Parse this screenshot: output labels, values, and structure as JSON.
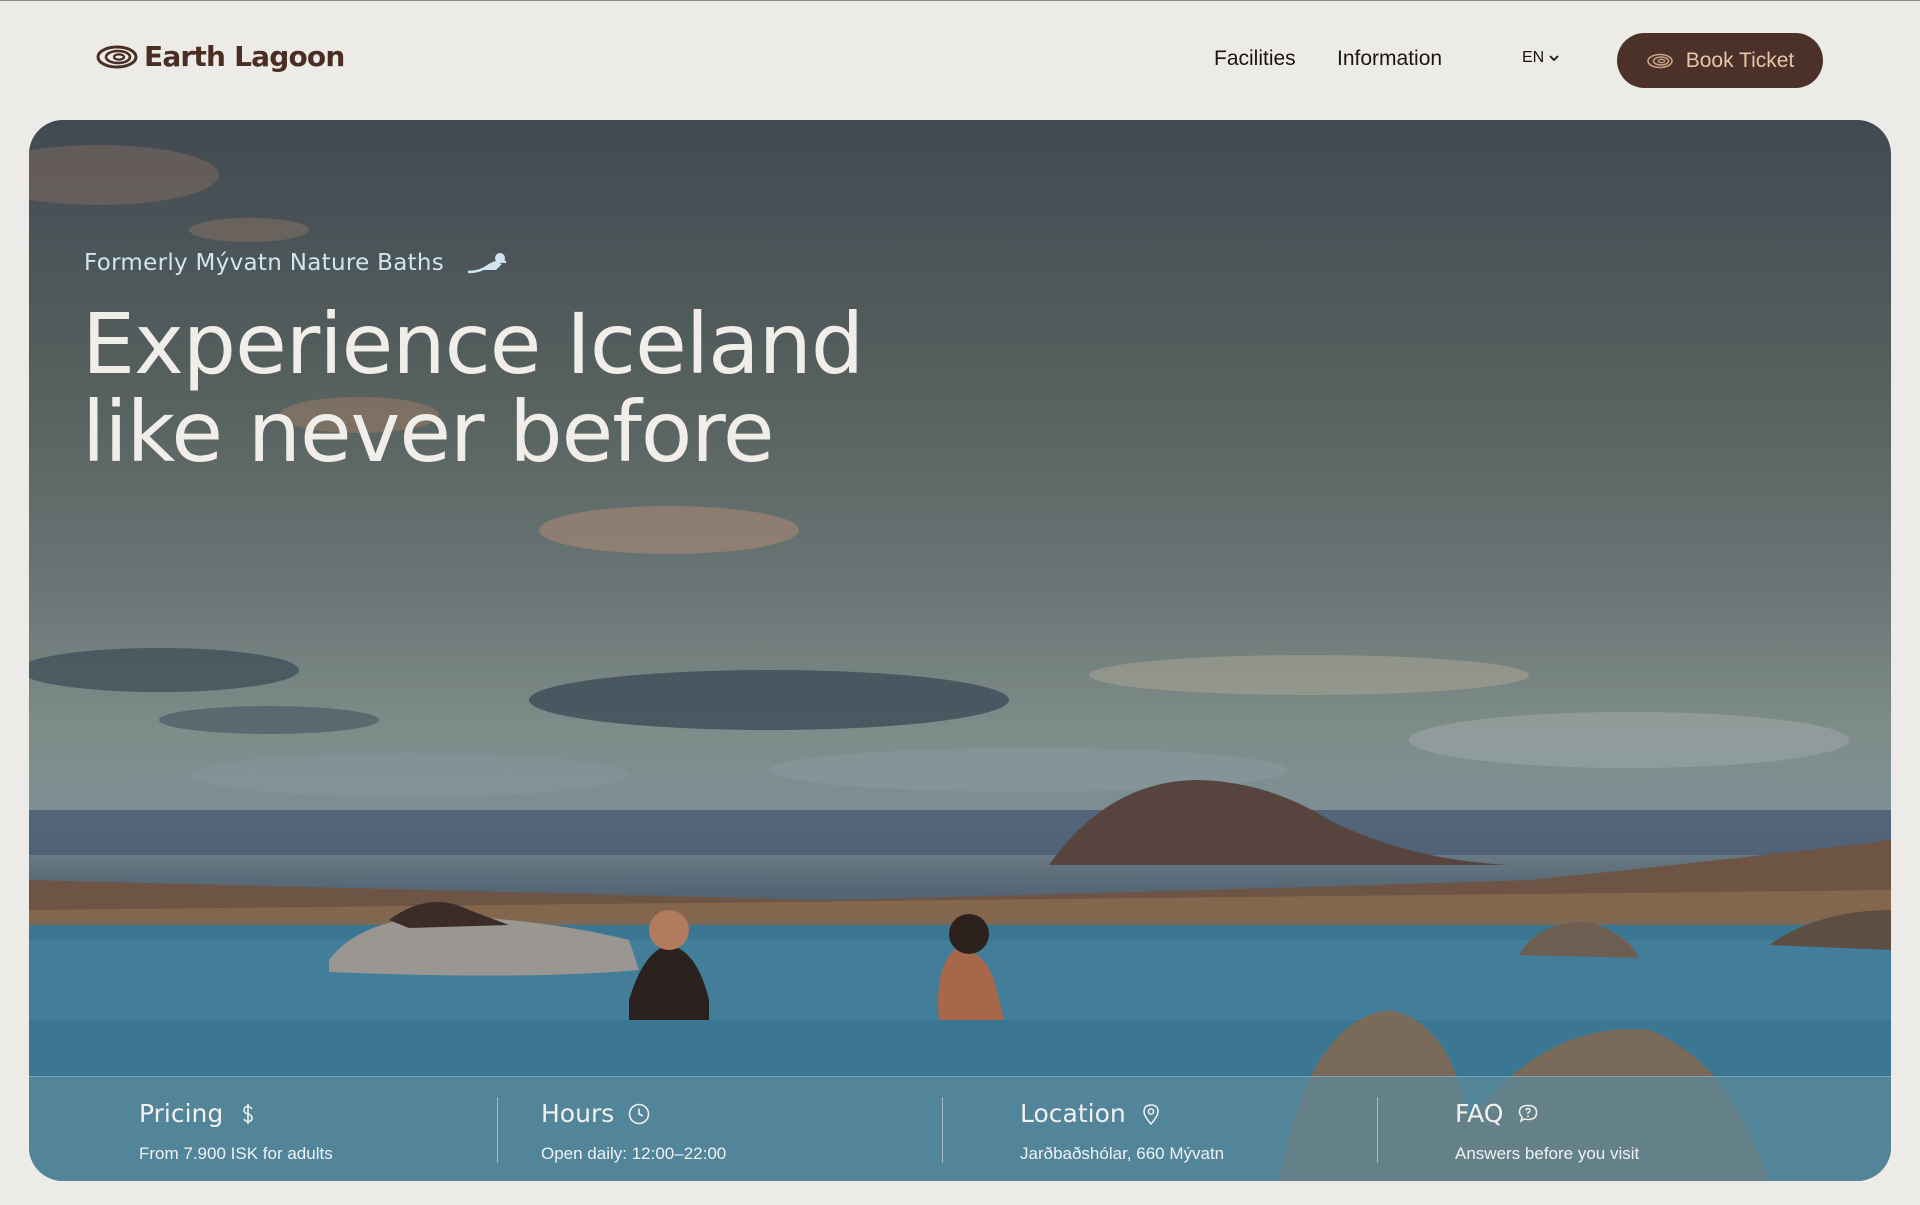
{
  "brand": {
    "name": "Earth Lagoon",
    "color": "#4a2e24"
  },
  "nav": {
    "facilities": "Facilities",
    "information": "Information",
    "language": "EN",
    "book_ticket": "Book Ticket"
  },
  "hero": {
    "eyebrow": "Formerly Mývatn Nature Baths",
    "headline_line1": "Experience Iceland",
    "headline_line2": "like never before"
  },
  "info": [
    {
      "title": "Pricing",
      "subtitle": "From 7.900 ISK for adults",
      "icon": "dollar-icon"
    },
    {
      "title": "Hours",
      "subtitle": "Open daily: 12:00–22:00",
      "icon": "clock-icon"
    },
    {
      "title": "Location",
      "subtitle": "Jarðbaðshólar, 660 Mývatn",
      "icon": "map-pin-icon"
    },
    {
      "title": "FAQ",
      "subtitle": "Answers before you visit",
      "icon": "chat-question-icon"
    }
  ],
  "colors": {
    "background": "#edebe8",
    "button": "#4b3129",
    "button_text": "#e7c6a8",
    "eyebrow": "#cfe6f2"
  }
}
